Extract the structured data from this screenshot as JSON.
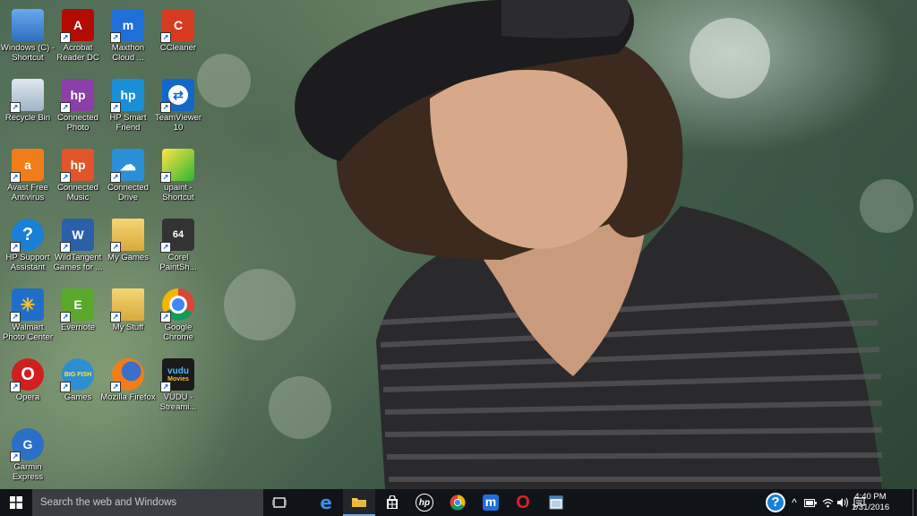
{
  "desktop": {
    "icons": [
      {
        "label": "Windows (C) - Shortcut",
        "icon": "drive-icon",
        "color": "#3b7fd6"
      },
      {
        "label": "Acrobat Reader DC",
        "icon": "acrobat-icon",
        "color": "#b30b00"
      },
      {
        "label": "Maxthon Cloud ...",
        "icon": "maxthon-icon",
        "color": "#1e6fd9"
      },
      {
        "label": "CCleaner",
        "icon": "ccleaner-icon",
        "color": "#d63b1f"
      },
      {
        "label": "Recycle Bin",
        "icon": "recycle-bin-icon",
        "color": "#9fb4c8"
      },
      {
        "label": "Connected Photo",
        "icon": "connected-photo-icon",
        "color": "#8b3fa8"
      },
      {
        "label": "HP Smart Friend",
        "icon": "hp-smart-friend-icon",
        "color": "#1a8fd6"
      },
      {
        "label": "TeamViewer 10",
        "icon": "teamviewer-icon",
        "color": "#1268c8"
      },
      {
        "label": "Avast Free Antivirus",
        "icon": "avast-icon",
        "color": "#f07d1a"
      },
      {
        "label": "Connected Music",
        "icon": "connected-music-icon",
        "color": "#e0562a"
      },
      {
        "label": "Connected Drive",
        "icon": "connected-drive-icon",
        "color": "#2a8fd6"
      },
      {
        "label": "upaint - Shortcut",
        "icon": "upaint-icon",
        "color": "#2fb52f"
      },
      {
        "label": "HP Support Assistant",
        "icon": "hp-support-icon",
        "color": "#1a7fd6"
      },
      {
        "label": "WildTangent Games for ...",
        "icon": "wildtangent-icon",
        "color": "#2b5fa8"
      },
      {
        "label": "My Games",
        "icon": "folder-icon",
        "color": "#e8c55a"
      },
      {
        "label": "Corel PaintSh...",
        "icon": "corel-icon",
        "color": "#333333"
      },
      {
        "label": "Walmart Photo Center",
        "icon": "walmart-icon",
        "color": "#1f6fc8"
      },
      {
        "label": "Evernote",
        "icon": "evernote-icon",
        "color": "#5aa82c"
      },
      {
        "label": "My Stuff",
        "icon": "folder-icon",
        "color": "#e8c55a"
      },
      {
        "label": "Google Chrome",
        "icon": "chrome-icon",
        "color": "#ffffff"
      },
      {
        "label": "Opera",
        "icon": "opera-icon",
        "color": "#d01f1f"
      },
      {
        "label": "Games",
        "icon": "big-fish-games-icon",
        "color": "#2e8fd0"
      },
      {
        "label": "Mozilla Firefox",
        "icon": "firefox-icon",
        "color": "#e8741a"
      },
      {
        "label": "VUDU - Streami...",
        "icon": "vudu-icon",
        "color": "#1a1a1a"
      },
      {
        "label": "Garmin Express",
        "icon": "garmin-icon",
        "color": "#2a6fc8"
      }
    ],
    "glyphs": {
      "acrobat": "A",
      "maxthon": "m",
      "hp": "hp",
      "ccleaner": "C",
      "avast": "a",
      "help": "?",
      "wildtangent": "W",
      "evernote": "E",
      "opera": "O",
      "vudu_top": "vudu",
      "vudu_bottom": "Movies",
      "garmin": "G",
      "corel": "64",
      "games": "BIG FISH"
    }
  },
  "taskbar": {
    "search_placeholder": "Search the web and Windows",
    "pinned": [
      {
        "name": "task-view-button",
        "icon": "task-view-icon"
      },
      {
        "name": "edge-button",
        "icon": "edge-icon",
        "glyph": "e"
      },
      {
        "name": "file-explorer-button",
        "icon": "folder-icon",
        "active": true
      },
      {
        "name": "store-button",
        "icon": "store-icon"
      },
      {
        "name": "hp-button",
        "icon": "hp-icon",
        "glyph": "hp"
      },
      {
        "name": "chrome-button",
        "icon": "chrome-icon"
      },
      {
        "name": "maxthon-button",
        "icon": "maxthon-icon",
        "glyph": "m"
      },
      {
        "name": "opera-button",
        "icon": "opera-icon",
        "glyph": "O"
      },
      {
        "name": "app-button",
        "icon": "window-app-icon"
      }
    ],
    "tray": {
      "help_glyph": "?",
      "chevron": "^",
      "time": "4:40 PM",
      "date": "1/31/2016"
    }
  }
}
